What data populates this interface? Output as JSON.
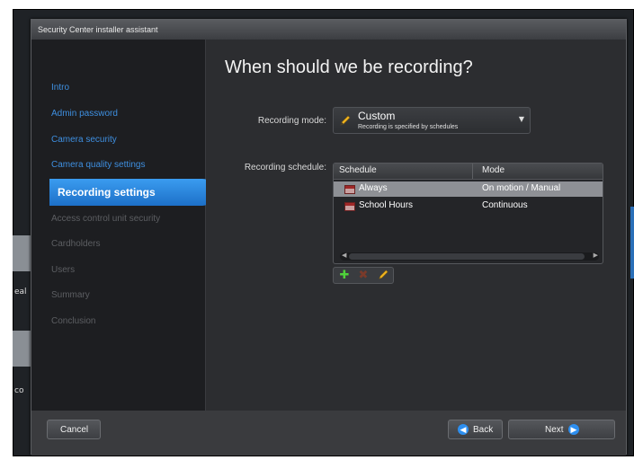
{
  "background": {
    "left_text": "eal",
    "left_text2": "co"
  },
  "window": {
    "title": "Security Center installer assistant"
  },
  "sidebar": {
    "items": [
      {
        "label": "Intro",
        "state": "link"
      },
      {
        "label": "Admin password",
        "state": "link"
      },
      {
        "label": "Camera security",
        "state": "link"
      },
      {
        "label": "Camera quality settings",
        "state": "link"
      },
      {
        "label": "Recording settings",
        "state": "active"
      },
      {
        "label": "Access control unit security",
        "state": "disabled"
      },
      {
        "label": "Cardholders",
        "state": "disabled"
      },
      {
        "label": "Users",
        "state": "disabled"
      },
      {
        "label": "Summary",
        "state": "disabled"
      },
      {
        "label": "Conclusion",
        "state": "disabled"
      }
    ]
  },
  "main": {
    "heading": "When should we be recording?",
    "recording_mode_label": "Recording mode:",
    "recording_mode": {
      "value": "Custom",
      "description": "Recording is specified by schedules",
      "icon": "pencil-icon"
    },
    "schedule_label": "Recording schedule:",
    "schedule_table": {
      "columns": [
        "Schedule",
        "Mode"
      ],
      "rows": [
        {
          "schedule": "Always",
          "mode": "On motion / Manual",
          "selected": true,
          "icon": "calendar-icon"
        },
        {
          "schedule": "School Hours",
          "mode": "Continuous",
          "selected": false,
          "icon": "calendar-icon"
        }
      ]
    },
    "tools": {
      "add": "plus-icon",
      "remove": "x-icon",
      "edit": "pencil-icon"
    }
  },
  "footer": {
    "cancel": "Cancel",
    "back": "Back",
    "next": "Next"
  },
  "colors": {
    "accent": "#2d8ff0",
    "link": "#3e8fe0",
    "disabled": "#5c5e62"
  }
}
